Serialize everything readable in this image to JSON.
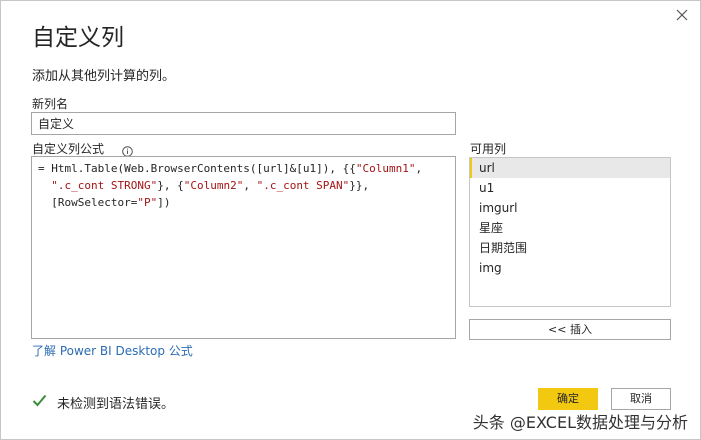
{
  "dialog": {
    "title": "自定义列",
    "subtitle": "添加从其他列计算的列。"
  },
  "new_column": {
    "label": "新列名",
    "value": "自定义"
  },
  "formula": {
    "label": "自定义列公式",
    "line1_a": "= Html.Table(Web.BrowserContents([url]&[u1]), {{",
    "line1_s1": "\"Column1\"",
    "line1_b": ",",
    "line2_s2": "\".c_cont STRONG\"",
    "line2_a": "}, {",
    "line2_s3": "\"Column2\"",
    "line2_b": ", ",
    "line2_s4": "\".c_cont SPAN\"",
    "line2_c": "}},",
    "line3_a": "[RowSelector=",
    "line3_s5": "\"P\"",
    "line3_b": "])"
  },
  "available_columns": {
    "label": "可用列",
    "items": [
      "url",
      "u1",
      "imgurl",
      "星座",
      "日期范围",
      "img"
    ],
    "selected_index": 0
  },
  "insert_button": "<< 插入",
  "learn_link": "了解 Power BI Desktop 公式",
  "status": "未检测到语法错误。",
  "buttons": {
    "ok": "确定",
    "cancel": "取消"
  },
  "watermark": "头条 @EXCEL数据处理与分析",
  "colors": {
    "accent": "#f2c811",
    "link": "#2b6cb3",
    "check": "#3c8c3c",
    "string": "#a31515"
  },
  "icons": {
    "close": "close-icon",
    "info": "info-icon",
    "check": "check-icon"
  }
}
